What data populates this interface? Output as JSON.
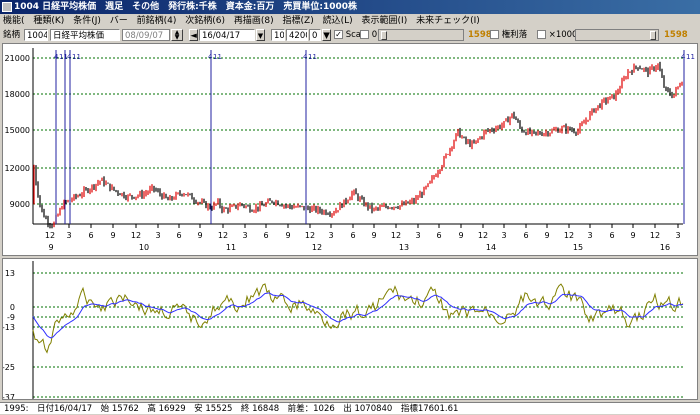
{
  "title": "1004 日経平均株価　週足　その他　発行株:千株　資本金:百万　売買単位:1000株",
  "menu": [
    "機能(",
    "種類(K)",
    "条件(J)",
    "バー",
    "前銘柄(4)",
    "次銘柄(6)",
    "再描画(8)",
    "指標(Z)",
    "読込(L)",
    "表示範囲(I)",
    "未来チェック(I)"
  ],
  "toolbar": {
    "code_label": "銘柄",
    "code_value": "1004",
    "name_value": "日経平均株価",
    "date_value": "08/09/07",
    "date2_value": "16/04/17",
    "span_value": "10",
    "range_value": "4200",
    "zero_value": "0",
    "scale_label": "Scale",
    "scale_value": "0",
    "count_badge": "1598",
    "kenri_label": "権利落",
    "mult_label": "×1000",
    "count_badge2": "1598",
    "step_up": "▲",
    "step_down": "▼",
    "arrow_left": "◄",
    "arrow_right": "►",
    "check_mark": "✓"
  },
  "colors": {
    "up": "#e00000",
    "down": "#000000",
    "osc1": "#808000",
    "osc2": "#3030ff",
    "vline": "#2020a0",
    "grid": "#007000"
  },
  "price_chart": {
    "y_labels": [
      "21000",
      "18000",
      "15000",
      "12000",
      "9000"
    ],
    "markers": [
      "4",
      "11",
      "4",
      "11",
      "4",
      "11",
      "4",
      "11",
      "4",
      "11",
      "4",
      "11",
      "4",
      "11"
    ],
    "x_months": [
      "12",
      "3",
      "6",
      "9",
      "12",
      "3",
      "6",
      "9",
      "12",
      "3",
      "6",
      "9",
      "12",
      "3",
      "6",
      "9",
      "12",
      "3",
      "6",
      "9",
      "12",
      "3",
      "6",
      "9",
      "12",
      "3",
      "6",
      "9",
      "12",
      "3"
    ],
    "x_years": [
      "9",
      "10",
      "11",
      "12",
      "13",
      "14",
      "15",
      "16"
    ]
  },
  "osc_chart": {
    "y_labels": [
      "13",
      "0",
      "-9",
      "-13",
      "-25",
      "-37"
    ]
  },
  "status": {
    "text": "1995:　日付16/04/17　始 15762　高 16929　安 15525　終 16848　前差：1026　出 1070840　指標17601.61"
  }
}
